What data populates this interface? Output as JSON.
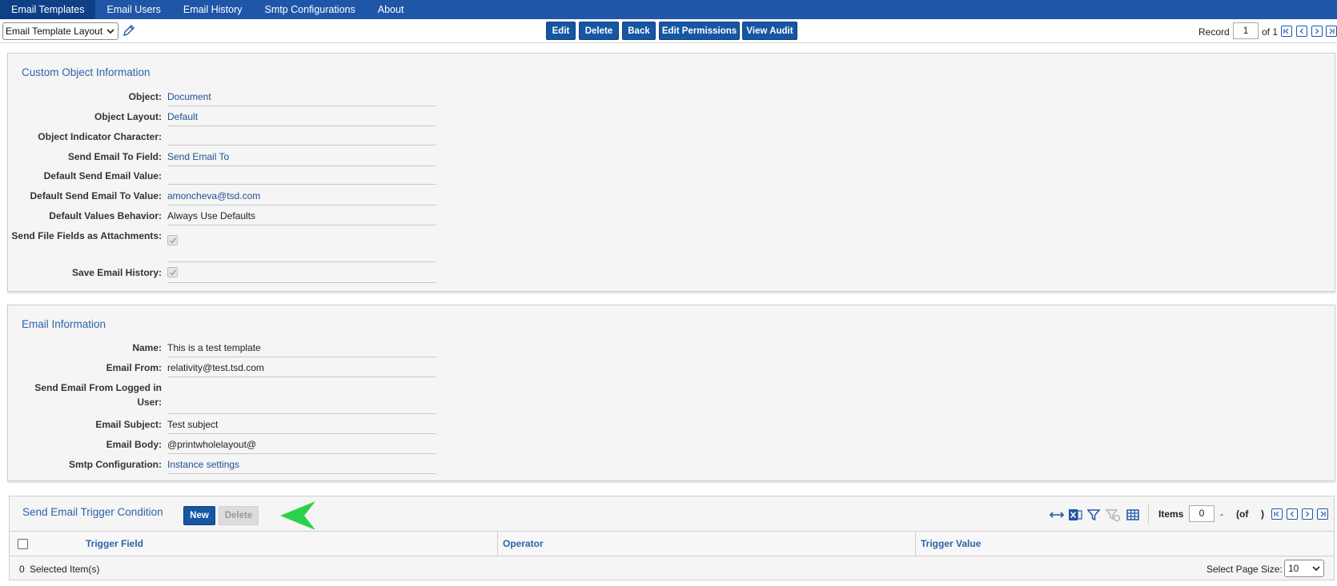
{
  "nav": {
    "tabs": [
      "Email Templates",
      "Email Users",
      "Email History",
      "Smtp Configurations",
      "About"
    ],
    "active_tab": "Email Templates"
  },
  "toolbar": {
    "layout_select": "Email Template Layout",
    "buttons": {
      "edit": "Edit",
      "delete": "Delete",
      "back": "Back",
      "edit_permissions": "Edit Permissions",
      "view_audit": "View Audit"
    },
    "record_label": "Record",
    "record_value": "1",
    "record_of": "of 1"
  },
  "custom_object": {
    "title": "Custom Object Information",
    "fields": [
      {
        "label": "Object:",
        "value": "Document"
      },
      {
        "label": "Object Layout:",
        "value": "Default"
      },
      {
        "label": "Object Indicator Character:",
        "value": ""
      },
      {
        "label": "Send Email To Field:",
        "value": "Send Email To"
      },
      {
        "label": "Default Send Email Value:",
        "value": ""
      },
      {
        "label": "Default Send Email To Value:",
        "value": "amoncheva@tsd.com"
      },
      {
        "label": "Default Values Behavior:",
        "value": "Always Use Defaults"
      },
      {
        "label": "Send File Fields as Attachments:",
        "checked": true
      },
      {
        "label": "Save Email History:",
        "checked": true
      }
    ]
  },
  "email_info": {
    "title": "Email Information",
    "fields": [
      {
        "label": "Name:",
        "value": "This is a test template"
      },
      {
        "label": "Email From:",
        "value": "relativity@test.tsd.com"
      },
      {
        "label": "Send Email From Logged in User:",
        "value": ""
      },
      {
        "label": "Email Subject:",
        "value": "Test subject"
      },
      {
        "label": "Email Body:",
        "value": "@printwholelayout@"
      },
      {
        "label": "Smtp Configuration:",
        "value": "Instance settings"
      }
    ]
  },
  "trigger": {
    "title": "Send Email Trigger Condition",
    "new_label": "New",
    "delete_label": "Delete",
    "items_label": "Items",
    "items_value": "0",
    "items_dash": "-",
    "items_of": "(of",
    "items_close": ")",
    "columns": [
      "Trigger Field",
      "Operator",
      "Trigger Value"
    ],
    "selected_count": "0",
    "selected_label": "Selected Item(s)",
    "page_size_label": "Select Page Size:",
    "page_size_value": "10"
  },
  "colors": {
    "nav_bg": "#1f56a8",
    "button_bg": "#1656a3",
    "accent_text": "#2c63a8",
    "arrow": "#2bd14a"
  }
}
